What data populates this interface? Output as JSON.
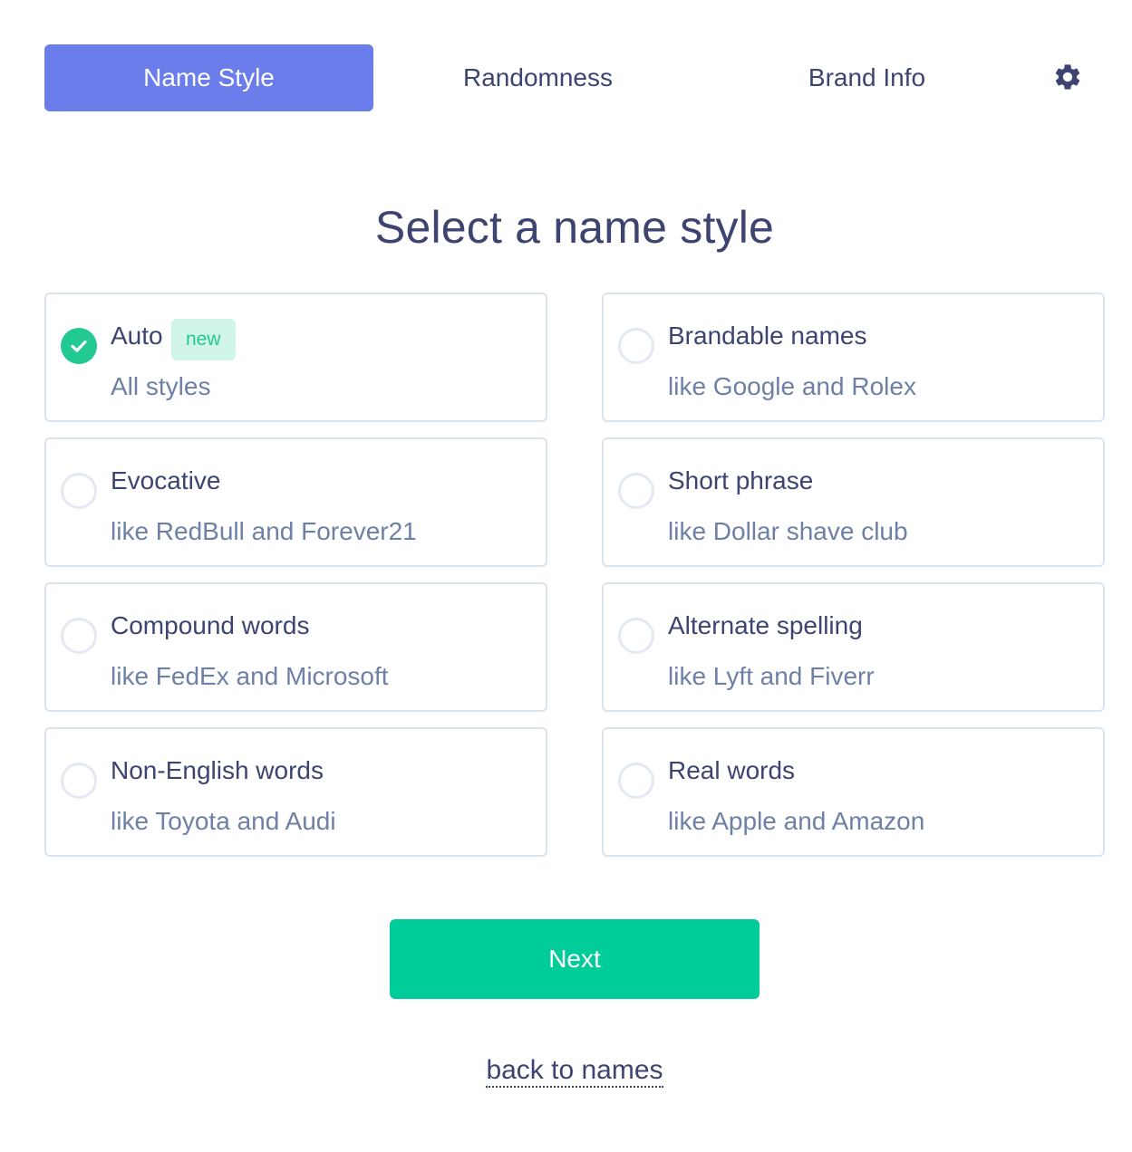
{
  "tabs": [
    {
      "label": "Name Style",
      "active": true
    },
    {
      "label": "Randomness",
      "active": false
    },
    {
      "label": "Brand Info",
      "active": false
    }
  ],
  "settings_icon": "gear-icon",
  "heading": "Select a name style",
  "styles": [
    {
      "title": "Auto",
      "badge": "new",
      "subtitle": "All styles",
      "selected": true
    },
    {
      "title": "Brandable names",
      "subtitle": "like Google and Rolex",
      "selected": false
    },
    {
      "title": "Evocative",
      "subtitle": "like RedBull and Forever21",
      "selected": false
    },
    {
      "title": "Short phrase",
      "subtitle": "like Dollar shave club",
      "selected": false
    },
    {
      "title": "Compound words",
      "subtitle": "like FedEx and Microsoft",
      "selected": false
    },
    {
      "title": "Alternate spelling",
      "subtitle": "like Lyft and Fiverr",
      "selected": false
    },
    {
      "title": "Non-English words",
      "subtitle": "like Toyota and Audi",
      "selected": false
    },
    {
      "title": "Real words",
      "subtitle": "like Apple and Amazon",
      "selected": false
    }
  ],
  "next_label": "Next",
  "back_label": "back to names",
  "colors": {
    "accent": "#6b7ceb",
    "primary_button": "#00cc99",
    "check": "#22c993",
    "text": "#3d4470",
    "muted": "#6e80a5"
  }
}
